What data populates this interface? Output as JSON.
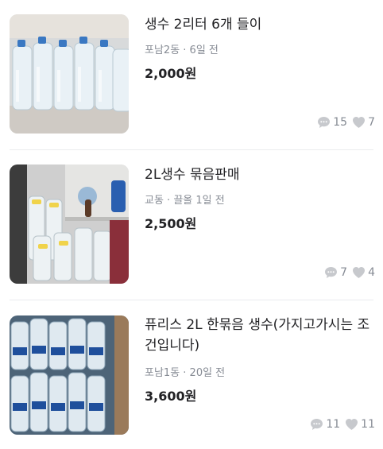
{
  "items": [
    {
      "title": "생수 2리터 6개 들이",
      "meta": "포남2동 · 6일 전",
      "price": "2,000원",
      "chats": "15",
      "likes": "7",
      "image": "water-bottles-pack-photo"
    },
    {
      "title": "2L생수 묶음판매",
      "meta": "교동 · 끌올 1일 전",
      "price": "2,500원",
      "chats": "7",
      "likes": "4",
      "image": "water-bottles-in-cabinet-photo"
    },
    {
      "title": "퓨리스 2L 한묶음 생수(가지고가시는 조건입니다)",
      "meta": "포남1동 · 20일 전",
      "price": "3,600원",
      "chats": "11",
      "likes": "11",
      "image": "water-bottles-stack-photo"
    }
  ],
  "icons": {
    "chat": "chat-bubble-icon",
    "like": "heart-icon"
  },
  "colors": {
    "text": "#212124",
    "muted": "#868b94",
    "divider": "#eaebee",
    "icon": "#c7c9cd"
  }
}
